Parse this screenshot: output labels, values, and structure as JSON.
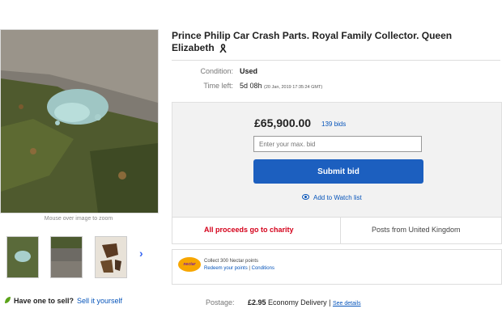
{
  "listing": {
    "title": "Prince Philip Car Crash Parts. Royal Family Collector. Queen Elizabeth",
    "title_icon": "black-ribbon-icon",
    "condition_label": "Condition:",
    "condition_value": "Used",
    "time_left_label": "Time left:",
    "time_left_value": "5d 08h",
    "time_left_detail": "(20 Jan, 2019   17:35:24 GMT)"
  },
  "gallery": {
    "zoom_note": "Mouse over image to zoom",
    "next_arrow": "›"
  },
  "bidding": {
    "price": "£65,900.00",
    "bids": "139 bids",
    "bid_placeholder": "Enter your max. bid",
    "submit_label": "Submit bid",
    "watch_label": "Add to Watch list"
  },
  "charity": {
    "text": "All proceeds go to charity",
    "posts_from": "Posts from United Kingdom"
  },
  "nectar": {
    "logo_text": "nectar",
    "collect": "Collect 300 Nectar points",
    "redeem": "Redeem your points",
    "separator": "|",
    "conditions": "Conditions"
  },
  "postage": {
    "label": "Postage:",
    "price": "£2.95",
    "method": "Economy Delivery |",
    "details_link": "See details"
  },
  "sell": {
    "question": "Have one to sell?",
    "link": "Sell it yourself"
  },
  "colors": {
    "link_blue": "#0654ba",
    "submit_blue": "#1c5fbf",
    "charity_red": "#d4001a",
    "nectar_orange": "#f7a600"
  }
}
